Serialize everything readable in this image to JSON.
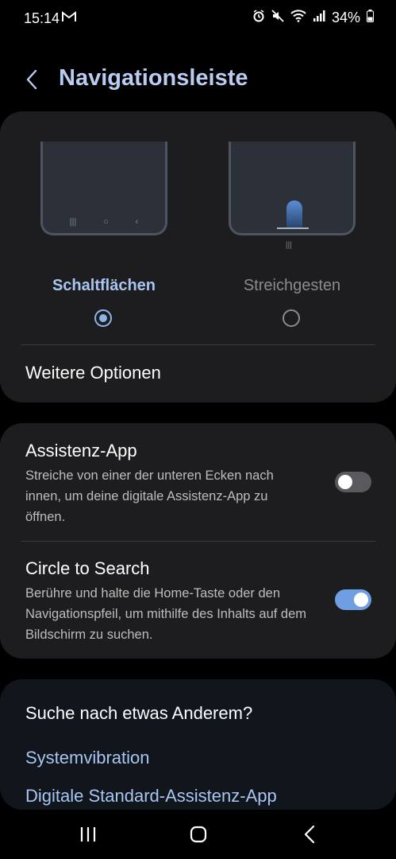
{
  "status_bar": {
    "time": "15:14",
    "battery": "34%",
    "icons": [
      "gmail-icon",
      "alarm-icon",
      "mute-icon",
      "wifi-icon",
      "signal-icon",
      "battery-icon"
    ]
  },
  "header": {
    "title": "Navigationsleiste",
    "back_icon": "chevron-left-icon"
  },
  "navigation_type": {
    "options": [
      {
        "label": "Schaltflächen",
        "selected": true
      },
      {
        "label": "Streichgesten",
        "selected": false
      }
    ],
    "more_options_label": "Weitere Optionen"
  },
  "settings": [
    {
      "title": "Assistenz-App",
      "description": "Streiche von einer der unteren Ecken nach innen, um deine digitale Assistenz-App zu öffnen.",
      "enabled": false
    },
    {
      "title": "Circle to Search",
      "description": "Berühre und halte die Home-Taste oder den Navigationspfeil, um mithilfe des Inhalts auf dem Bildschirm zu suchen.",
      "enabled": true
    }
  ],
  "suggestions": {
    "title": "Suche nach etwas Anderem?",
    "links": [
      "Systemvibration",
      "Digitale Standard-Assistenz-App"
    ]
  },
  "nav_bar": {
    "buttons": [
      "recents-icon",
      "home-icon",
      "back-icon"
    ]
  },
  "colors": {
    "accent": "#a8c6f1",
    "title": "#b9cdf3",
    "toggle_on": "#6f9ee3",
    "card": "#1d1d1f"
  }
}
